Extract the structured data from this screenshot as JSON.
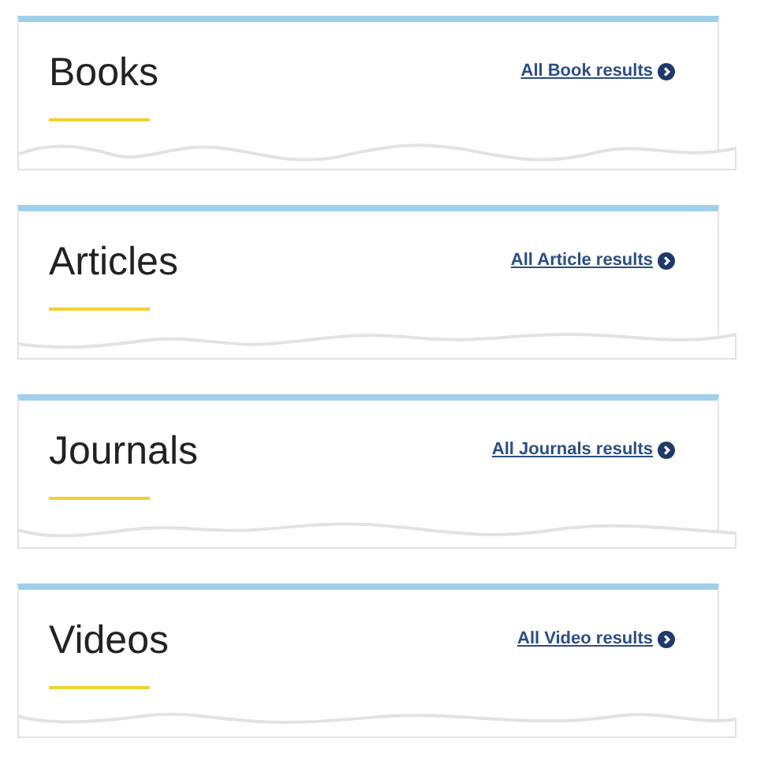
{
  "sections": [
    {
      "title": "Books",
      "link": "All Book results"
    },
    {
      "title": "Articles",
      "link": "All Article results"
    },
    {
      "title": "Journals",
      "link": "All Journals results"
    },
    {
      "title": "Videos",
      "link": "All Video results"
    }
  ]
}
